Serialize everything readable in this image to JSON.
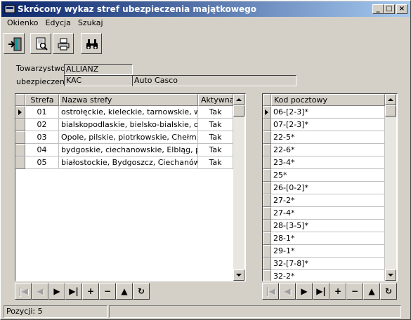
{
  "window": {
    "title": "Skrócony wykaz stref ubezpieczenia majątkowego"
  },
  "menu": [
    "Okienko",
    "Edycja",
    "Szukaj"
  ],
  "toolbar": [
    "exit-icon",
    "preview-icon",
    "print-icon",
    "binoculars-icon"
  ],
  "form": {
    "towarzystwo_label": "Towarzystwo",
    "towarzystwo_value": "ALLIANZ",
    "ubezpieczenie_label": "ubezpieczenie",
    "ubezpieczenie_code": "KAC",
    "ubezpieczenie_name": "Auto Casco"
  },
  "zones_grid": {
    "headers": [
      "Strefa",
      "Nazwa strefy",
      "Aktywna"
    ],
    "rows": [
      [
        "01",
        "ostrołęckie, kieleckie, tarnowskie, włocła",
        "Tak"
      ],
      [
        "02",
        "bialskopodlaskie, bielsko-bialskie, opolski",
        "Tak"
      ],
      [
        "03",
        "Opole, pilskie, piotrkowskie, Chełm, płoc",
        "Tak"
      ],
      [
        "04",
        "bydgoskie, ciechanowskie, Elbląg, pozna",
        "Tak"
      ],
      [
        "05",
        "białostockie, Bydgoszcz, Ciechanów, Gd",
        "Tak"
      ]
    ]
  },
  "postal_grid": {
    "header": "Kod pocztowy",
    "rows": [
      "06-[2-3]*",
      "07-[2-3]*",
      "22-5*",
      "22-6*",
      "23-4*",
      "25*",
      "26-[0-2]*",
      "27-2*",
      "27-4*",
      "28-[3-5]*",
      "28-1*",
      "29-1*",
      "32-[7-8]*",
      "32-2*"
    ]
  },
  "navigator": [
    "|◀",
    "◀",
    "▶",
    "▶|",
    "+",
    "−",
    "▲",
    "↻"
  ],
  "status": {
    "count": "Pozycji: 5"
  }
}
